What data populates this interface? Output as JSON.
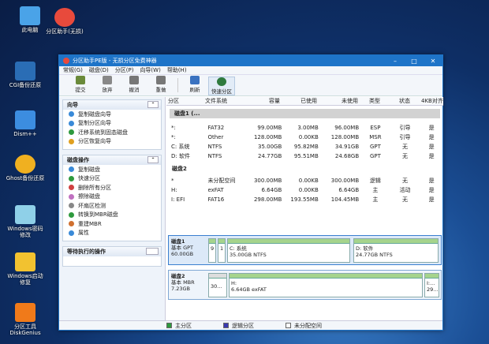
{
  "desktop": {
    "icons": [
      {
        "name": "computer",
        "label": "此电脑",
        "color": "#4aa3e8"
      },
      {
        "name": "partition-assistant",
        "label": "分区助手(无损)",
        "color": "#e84a3c"
      },
      {
        "name": "cgi",
        "label": "CGI备份还原",
        "color": "#2a6db5"
      },
      {
        "name": "dism",
        "label": "Dism++",
        "color": "#3c8de0"
      },
      {
        "name": "ghost",
        "label": "Ghost备份还原",
        "color": "#f0b020"
      },
      {
        "name": "windows-pw",
        "label": "Windows密码修改",
        "color": "#8fd0e8"
      },
      {
        "name": "windows-boot",
        "label": "Windows启动修复",
        "color": "#f2c230"
      },
      {
        "name": "diskgenius",
        "label": "分区工具DiskGenius",
        "color": "#f07a1a"
      }
    ]
  },
  "window": {
    "title": "分区助手PE版 - 无损分区免费神器",
    "buttons": [
      "–",
      "□",
      "✕"
    ]
  },
  "menu": [
    "常规(G)",
    "磁盘(D)",
    "分区(P)",
    "向导(W)",
    "帮助(H)"
  ],
  "toolbar": [
    {
      "label": "提交",
      "color": "#6a8a3a"
    },
    {
      "label": "放弃",
      "color": "#888"
    },
    {
      "label": "撤消",
      "color": "#777"
    },
    {
      "label": "重做",
      "color": "#777"
    },
    {
      "label": "刷新",
      "color": "#3a72c0"
    },
    {
      "label": "快速分区",
      "color": "#2e7a3e"
    }
  ],
  "left": {
    "wizard": {
      "title": "向导",
      "items": [
        "复制磁盘向导",
        "复制分区向导",
        "迁移系统到固态磁盘",
        "分区恢复向导"
      ]
    },
    "diskops": {
      "title": "磁盘操作",
      "items": [
        "复制磁盘",
        "快速分区",
        "删除所有分区",
        "擦除磁盘",
        "坏扇区检测",
        "转换到MBR磁盘",
        "重建MBR",
        "属性"
      ]
    },
    "pending": {
      "title": "等待执行的操作"
    }
  },
  "table": {
    "headers": [
      "分区",
      "文件系统",
      "容量",
      "已使用",
      "未使用",
      "类型",
      "状态",
      "4KB对齐"
    ],
    "disk1": {
      "label": "磁盘1 (...",
      "rows": [
        [
          "*:",
          "FAT32",
          "99.00MB",
          "3.00MB",
          "96.00MB",
          "ESP",
          "引导",
          "是"
        ],
        [
          "*:",
          "Other",
          "128.00MB",
          "0.00KB",
          "128.00MB",
          "MSR",
          "引导",
          "是"
        ],
        [
          "C: 系统",
          "NTFS",
          "35.00GB",
          "95.82MB",
          "34.91GB",
          "GPT",
          "无",
          "是"
        ],
        [
          "D: 软件",
          "NTFS",
          "24.77GB",
          "95.51MB",
          "24.68GB",
          "GPT",
          "无",
          "是"
        ]
      ]
    },
    "disk2": {
      "label": "磁盘2",
      "rows": [
        [
          "*",
          "未分配空间",
          "300.00MB",
          "0.00KB",
          "300.00MB",
          "逻辑",
          "无",
          "是"
        ],
        [
          "H:",
          "exFAT",
          "6.64GB",
          "0.00KB",
          "6.64GB",
          "主",
          "活动",
          "是"
        ],
        [
          "I: EFI",
          "FAT16",
          "298.00MB",
          "193.55MB",
          "104.45MB",
          "主",
          "无",
          "是"
        ]
      ]
    }
  },
  "map": {
    "disk1": {
      "name": "磁盘1",
      "type": "基本 GPT",
      "size": "60.00GB",
      "seg_small1": "9",
      "seg_small2": "1",
      "c_label": "C: 系统",
      "c_info": "35.00GB NTFS",
      "d_label": "D: 软件",
      "d_info": "24.77GB NTFS"
    },
    "disk2": {
      "name": "磁盘2",
      "type": "基本 MBR",
      "size": "7.23GB",
      "seg_un": "30...",
      "h_label": "H:",
      "h_info": "6.64GB exFAT",
      "i_label": "I:...",
      "i_info": "29..."
    }
  },
  "status": {
    "primary": "主分区",
    "logical": "逻辑分区",
    "unalloc": "未分配空间",
    "primary_color": "#2e9a3e",
    "logical_color": "#3a3ab0",
    "unalloc_color": "#ffffff"
  }
}
